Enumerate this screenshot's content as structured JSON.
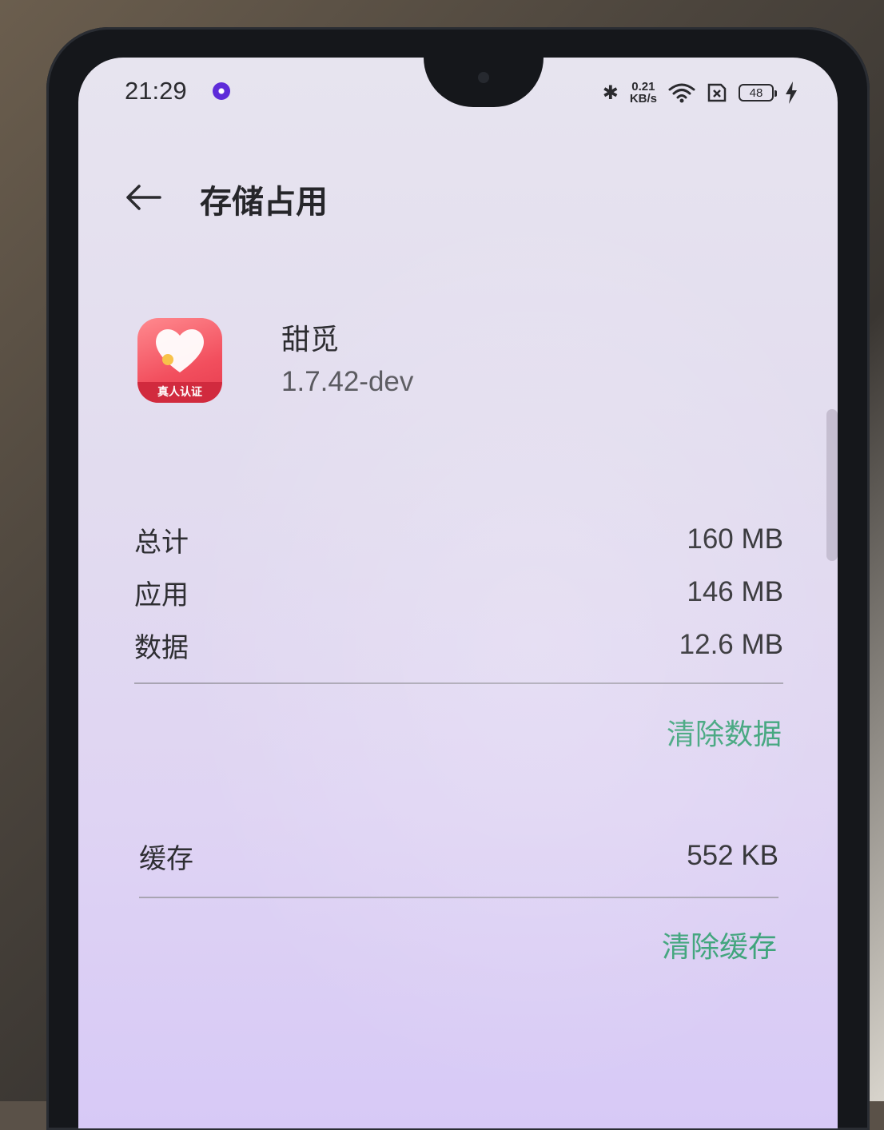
{
  "status_bar": {
    "time": "21:29",
    "net_speed_value": "0.21",
    "net_speed_unit": "KB/s",
    "battery_level": "48"
  },
  "header": {
    "title": "存储占用"
  },
  "app": {
    "name": "甜觅",
    "version": "1.7.42-dev",
    "icon_badge": "真人认证"
  },
  "storage": {
    "rows": [
      {
        "label": "总计",
        "value": "160 MB"
      },
      {
        "label": "应用",
        "value": "146 MB"
      },
      {
        "label": "数据",
        "value": "12.6 MB"
      }
    ],
    "clear_data_label": "清除数据",
    "cache_label": "缓存",
    "cache_value": "552 KB",
    "clear_cache_label": "清除缓存"
  },
  "colors": {
    "accent": "#3da37a",
    "text": "#2e2e32",
    "app_icon": "#f24f5e"
  }
}
